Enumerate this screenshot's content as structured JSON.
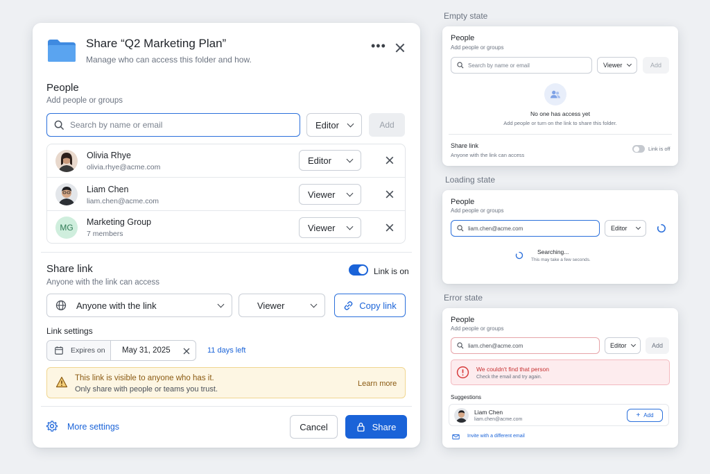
{
  "dialog": {
    "title": "Share “Q2 Marketing Plan”",
    "subtitle": "Manage who can access this folder and how.",
    "people_title": "People",
    "people_sub": "Add people or groups",
    "search_placeholder": "Search by name or email",
    "role_select": "Editor",
    "add_label": "Add",
    "members": [
      {
        "name": "Olivia Rhye",
        "detail": "olivia.rhye@acme.com",
        "role": "Editor"
      },
      {
        "name": "Liam Chen",
        "detail": "liam.chen@acme.com",
        "role": "Viewer"
      },
      {
        "name": "Marketing Group",
        "detail": "7 members",
        "role": "Viewer",
        "initials": "MG"
      }
    ],
    "share_link_title": "Share link",
    "share_link_sub": "Anyone with the link can access",
    "link_toggle_label": "Link is on",
    "audience": "Anyone with the link",
    "link_role": "Viewer",
    "copy_link": "Copy link",
    "link_settings": "Link settings",
    "expires_label": "Expires on",
    "expires_date": "May 31, 2025",
    "days_left": "11 days left",
    "warning_title": "This link is visible to anyone who has it.",
    "warning_body": "Only share with people or teams you trust.",
    "learn_more": "Learn more",
    "more_settings": "More settings",
    "cancel": "Cancel",
    "share": "Share"
  },
  "empty_state": {
    "label": "Empty state",
    "people_title": "People",
    "people_sub": "Add people or groups",
    "search_placeholder": "Search by name or email",
    "role": "Viewer",
    "add": "Add",
    "empty_title": "No one has access yet",
    "empty_sub": "Add people or turn on the link to share this folder.",
    "share_link_title": "Share link",
    "share_link_sub": "Anyone with the link can access",
    "toggle_label": "Link is off"
  },
  "loading_state": {
    "label": "Loading state",
    "people_title": "People",
    "people_sub": "Add people or groups",
    "search_value": "liam.chen@acme.com",
    "role": "Editor",
    "searching": "Searching...",
    "searching_sub": "This may take a few seconds."
  },
  "error_state": {
    "label": "Error state",
    "people_title": "People",
    "people_sub": "Add people or groups",
    "search_value": "liam.chen@acme.com",
    "role": "Editor",
    "add": "Add",
    "error_title": "We couldn't find that person",
    "error_sub": "Check the email and try again.",
    "suggestions": "Suggestions",
    "suggestion_name": "Liam Chen",
    "suggestion_email": "liam.chen@acme.com",
    "suggestion_add": "Add",
    "invite": "Invite with a different email"
  },
  "colors": {
    "accent": "#1a63d8",
    "warning_bg": "#fdf6e3",
    "error_bg": "#fdecee",
    "error": "#d63a3a",
    "folder": "#4b98e8"
  }
}
